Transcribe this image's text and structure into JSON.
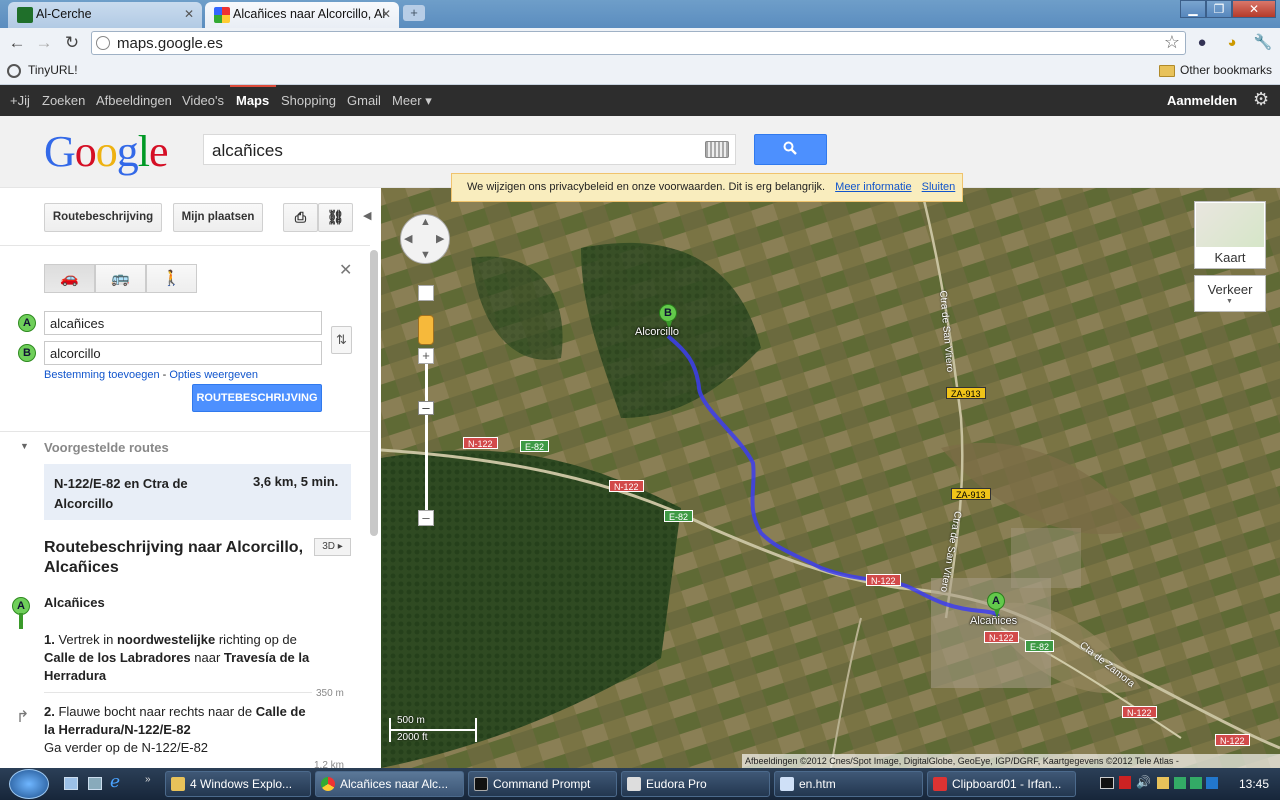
{
  "browser": {
    "tabs": [
      {
        "title": "Al-Cerche"
      },
      {
        "title": "Alcañices naar Alcorcillo, Al"
      }
    ],
    "url": "maps.google.es",
    "bookmarks": {
      "tinyurl": "TinyURL!",
      "other": "Other bookmarks"
    }
  },
  "gbar": {
    "items": [
      "+Jij",
      "Zoeken",
      "Afbeeldingen",
      "Video's",
      "Maps",
      "Shopping",
      "Gmail",
      "Meer ▾"
    ],
    "signin": "Aanmelden"
  },
  "search": {
    "query": "alcañices"
  },
  "panel": {
    "directions_tab": "Routebeschrijving",
    "myplaces_tab": "Mijn plaatsen",
    "start": "alcañices",
    "end": "alcorcillo",
    "add_destination": "Bestemming toevoegen",
    "sep": " - ",
    "show_options": "Opties weergeven",
    "get_directions": "ROUTEBESCHRIJVING",
    "suggested_routes": "Voorgestelde routes",
    "route_name": "N-122/E-82 en Ctra de Alcorcillo",
    "route_meta": "3,6 km, 5 min.",
    "directions_title": "Routebeschrijving naar Alcorcillo, Alcañices",
    "threed": "3D",
    "start_place": "Alcañices",
    "steps": [
      {
        "num": "1.",
        "t1": " Vertrek in ",
        "b1": "noordwestelijke",
        "t2": " richting op de ",
        "b2": "Calle de los Labradores",
        "t3": " naar ",
        "b3": "Travesía de la Herradura",
        "dist": "350 m"
      },
      {
        "num": "2.",
        "t1": " Flauwe bocht naar rechts naar de ",
        "b1": "Calle de la Herradura/N-122/E-82",
        "extra": "Ga verder op de N-122/E-82",
        "dist": "1,2 km"
      }
    ]
  },
  "map": {
    "privacy_text": "We wijzigen ons privacybeleid en onze voorwaarden. Dit is erg belangrijk.",
    "privacy_more": "Meer informatie",
    "privacy_close": "Sluiten",
    "map_type": "Kaart",
    "traffic": "Verkeer",
    "places": {
      "a": "Alcañices",
      "b": "Alcorcillo"
    },
    "road_labels": [
      "N-122",
      "E-82",
      "N-122",
      "E-82",
      "N-122",
      "N-122",
      "E-82",
      "N-122",
      "N-122"
    ],
    "yellow_labels": [
      "ZA-913",
      "ZA-913"
    ],
    "street_labels": [
      "Ctra de San Vitero",
      "Ctra de San Vitero",
      "Cta de Zamora"
    ],
    "scale_m": "500 m",
    "scale_ft": "2000 ft",
    "attribution": "Afbeeldingen ©2012 Cnes/Spot Image, DigitalGlobe, GeoEye, IGP/DGRF, Kaartgegevens ©2012 Tele Atlas -"
  },
  "taskbar": {
    "items": [
      "4 Windows Explo...",
      "Alcañices naar Alc...",
      "Command Prompt",
      "Eudora Pro",
      "en.htm",
      "Clipboard01 - Irfan..."
    ],
    "clock": "13:45"
  }
}
